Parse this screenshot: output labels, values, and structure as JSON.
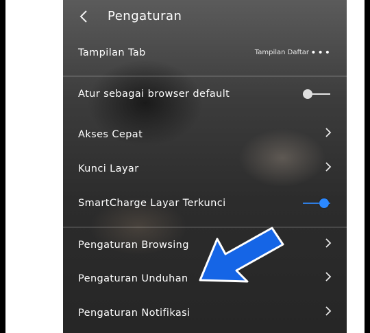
{
  "header": {
    "back_icon": "chevron-left-icon",
    "title": "Pengaturan"
  },
  "settings": {
    "tab_view": {
      "label": "Tampilan Tab",
      "value": "Tampilan Daftar",
      "more_icon": "more-horizontal-icon"
    },
    "default_browser": {
      "label": "Atur sebagai browser default",
      "toggle_on": false
    },
    "quick_access": {
      "label": "Akses Cepat"
    },
    "screen_lock": {
      "label": "Kunci Layar"
    },
    "smartcharge": {
      "label": "SmartCharge Layar Terkunci",
      "toggle_on": true
    },
    "browsing_settings": {
      "label": "Pengaturan Browsing"
    },
    "download_settings": {
      "label": "Pengaturan Unduhan"
    },
    "notification_settings": {
      "label": "Pengaturan Notifikasi"
    }
  },
  "colors": {
    "toggle_on": "#2b88ff",
    "pointer_arrow": "#1565e6"
  },
  "annotation": {
    "icon": "pointer-arrow-icon"
  }
}
